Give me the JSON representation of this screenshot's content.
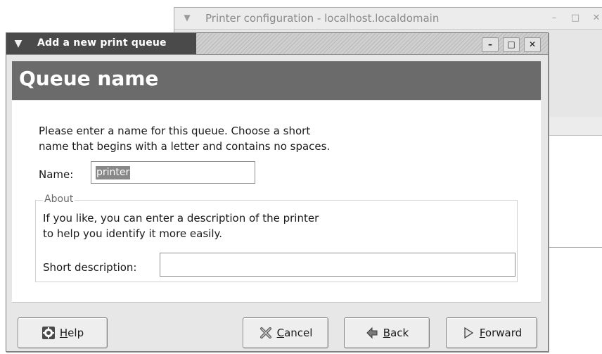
{
  "background_window": {
    "title": "Printer configuration - localhost.localdomain"
  },
  "dialog": {
    "title": "Add a new print queue",
    "header": "Queue name",
    "intro_line1": "Please enter a name for this queue.  Choose a short",
    "intro_line2": "name that begins with a letter and contains no spaces.",
    "name_label": "Name:",
    "name_value": "printer",
    "about_legend": "About",
    "about_line1": "If you like, you can enter a description of the printer",
    "about_line2": "to help you identify it more easily.",
    "short_desc_label": "Short description:",
    "short_desc_value": ""
  },
  "buttons": {
    "help": {
      "mnemonic": "H",
      "rest": "elp",
      "icon": "help-icon"
    },
    "cancel": {
      "mnemonic": "C",
      "rest": "ancel",
      "icon": "cancel-x-icon"
    },
    "back": {
      "mnemonic": "B",
      "rest": "ack",
      "icon": "back-arrow-icon"
    },
    "forward": {
      "mnemonic": "F",
      "rest": "orward",
      "icon": "forward-arrow-icon"
    }
  },
  "colors": {
    "header_band": "#6b6b6b",
    "titlebar_active": "#4a4a4a",
    "selection": "#888888"
  }
}
